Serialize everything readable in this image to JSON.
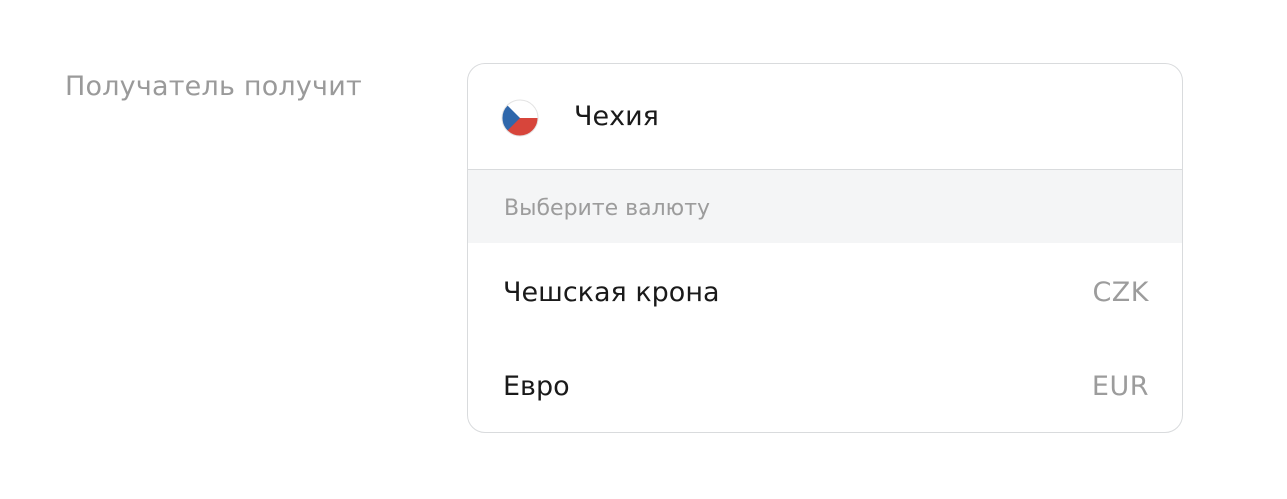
{
  "field": {
    "label": "Получатель получит"
  },
  "country": {
    "name": "Чехия",
    "flag_icon": "czech-flag-icon",
    "flag_colors": {
      "top": "#ffffff",
      "bottom": "#d7453b",
      "triangle": "#2f67ab"
    }
  },
  "currency_section": {
    "header": "Выберите валюту",
    "options": [
      {
        "name": "Чешская крона",
        "code": "CZK"
      },
      {
        "name": "Евро",
        "code": "EUR"
      }
    ]
  }
}
